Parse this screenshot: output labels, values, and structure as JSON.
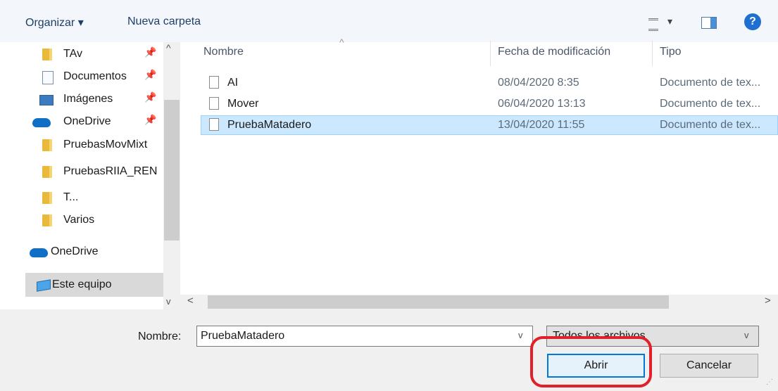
{
  "toolbar": {
    "organize_label": "Organizar ▾",
    "new_folder_label": "Nueva carpeta",
    "view_chevron": "▾",
    "help_label": "?"
  },
  "nav": {
    "items": [
      {
        "label": "TAv",
        "icon": "folder-icon",
        "pinned": true
      },
      {
        "label": "Documentos",
        "icon": "documents-icon",
        "pinned": true
      },
      {
        "label": "Imágenes",
        "icon": "pictures-icon",
        "pinned": true
      },
      {
        "label": "OneDrive",
        "icon": "onedrive-icon",
        "pinned": true
      },
      {
        "label": "PruebasMovMixt",
        "icon": "folder-icon",
        "pinned": false
      },
      {
        "label": "PruebasRIIA_REN",
        "icon": "folder-icon",
        "pinned": false
      },
      {
        "label": "T...",
        "icon": "folder-icon",
        "pinned": false
      },
      {
        "label": "Varios",
        "icon": "folder-icon",
        "pinned": false
      },
      {
        "label": "OneDrive",
        "icon": "onedrive-icon",
        "pinned": false
      },
      {
        "label": "Este equipo",
        "icon": "this-pc-icon",
        "pinned": false
      }
    ],
    "pin_glyph": "📌"
  },
  "list": {
    "columns": {
      "name": "Nombre",
      "date": "Fecha de modificación",
      "type": "Tipo"
    },
    "rows": [
      {
        "name": "AI",
        "date": "08/04/2020 8:35",
        "type": "Documento de tex..."
      },
      {
        "name": "Mover",
        "date": "06/04/2020 13:13",
        "type": "Documento de tex..."
      },
      {
        "name": "PruebaMatadero",
        "date": "13/04/2020 11:55",
        "type": "Documento de tex..."
      }
    ]
  },
  "bottom": {
    "name_label": "Nombre:",
    "name_value": "PruebaMatadero",
    "filter_value": "Todos los archivos",
    "open_label": "Abrir",
    "cancel_label": "Cancelar"
  },
  "colors": {
    "selection": "#cce8ff",
    "highlight": "#e0202a",
    "accent": "#0078d7"
  }
}
